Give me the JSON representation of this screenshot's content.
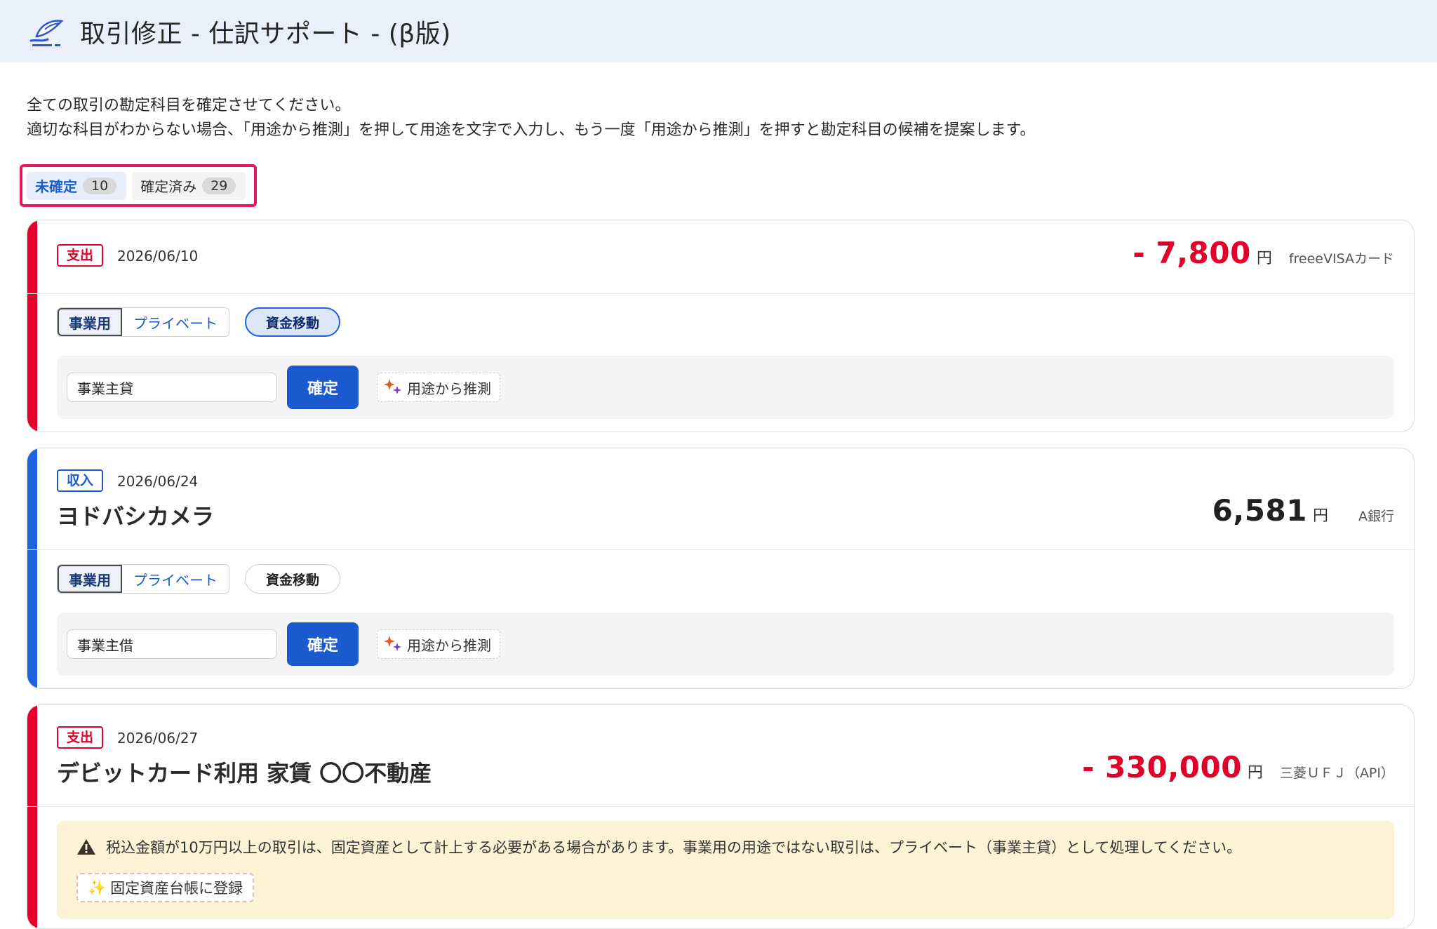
{
  "header": {
    "title": "取引修正 - 仕訳サポート - (β版)",
    "logo_icon": "freee-logo-icon"
  },
  "instructions": {
    "line1": "全ての取引の勘定科目を確定させてください。",
    "line2": "適切な科目がわからない場合、「用途から推測」を押して用途を文字で入力し、もう一度「用途から推測」を押すと勘定科目の候補を提案します。"
  },
  "tabs": [
    {
      "label": "未確定",
      "count": "10",
      "active": true
    },
    {
      "label": "確定済み",
      "count": "29",
      "active": false
    }
  ],
  "colors": {
    "expense": "#e0002a",
    "income": "#1d63e0",
    "primary": "#1a5cd0",
    "header_bg": "#e9f0fc",
    "tab_highlight": "#e8195a"
  },
  "transactions": [
    {
      "type_label": "支出",
      "date": "2026/06/10",
      "vendor": "",
      "amount": "- 7,800",
      "currency": "円",
      "account": "freeeVISAカード",
      "use_business": "事業用",
      "use_private": "プライベート",
      "transfer": "資金移動",
      "transfer_selected": true,
      "account_value": "事業主貸",
      "confirm": "確定",
      "guess": "用途から推測"
    },
    {
      "type_label": "収入",
      "date": "2026/06/24",
      "vendor": "ヨドバシカメラ",
      "amount": "6,581",
      "currency": "円",
      "account": "A銀行",
      "use_business": "事業用",
      "use_private": "プライベート",
      "transfer": "資金移動",
      "transfer_selected": false,
      "account_value": "事業主借",
      "confirm": "確定",
      "guess": "用途から推測"
    },
    {
      "type_label": "支出",
      "date": "2026/06/27",
      "vendor": "デビットカード利用 家賃 〇〇不動産",
      "amount": "- 330,000",
      "currency": "円",
      "account": "三菱ＵＦＪ（API）",
      "warning": "税込金額が10万円以上の取引は、固定資産として計上する必要がある場合があります。事業用の用途ではない取引は、プライベート（事業主貸）として処理してください。",
      "asset_button": "固定資産台帳に登録"
    }
  ]
}
